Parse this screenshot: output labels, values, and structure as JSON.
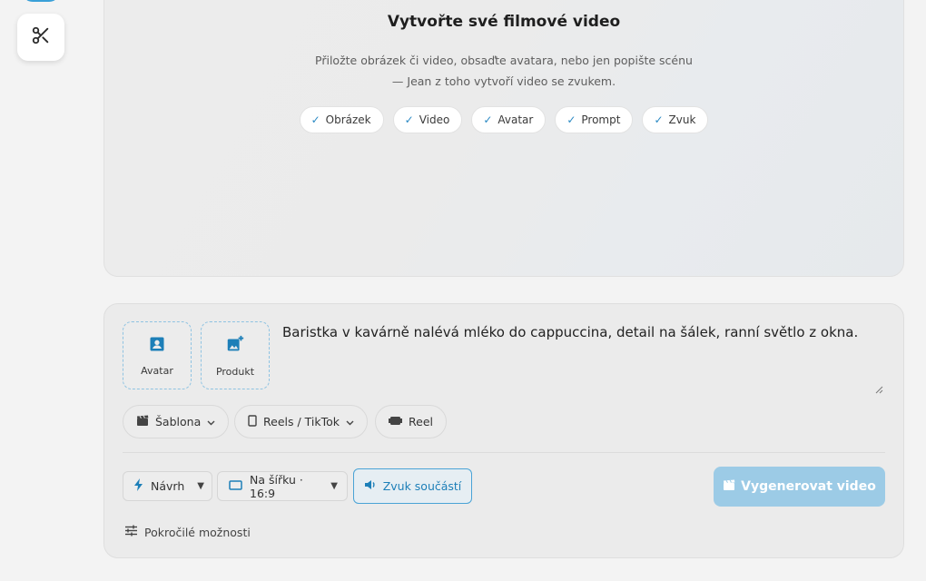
{
  "rail": {
    "tool_icon": "scissors-icon"
  },
  "hero": {
    "title": "Vytvořte své filmové video",
    "subtitle_line1": "Přiložte obrázek či video, obsaďte avatara, nebo jen popište scénu",
    "subtitle_line2": "— Jean z toho vytvoří video se zvukem.",
    "chips": [
      {
        "label": "Obrázek",
        "icon": "check-icon"
      },
      {
        "label": "Video",
        "icon": "check-icon"
      },
      {
        "label": "Avatar",
        "icon": "check-icon"
      },
      {
        "label": "Prompt",
        "icon": "check-icon"
      },
      {
        "label": "Zvuk",
        "icon": "check-icon"
      }
    ]
  },
  "composer": {
    "uploads": {
      "avatar_label": "Avatar",
      "product_label": "Produkt"
    },
    "prompt_text": "Baristka v kavárně nalévá mléko do cappuccina, detail na šálek, ranní světlo z okna.",
    "pills": {
      "template_label": "Šablona",
      "format_label": "Reels / TikTok",
      "reel_label": "Reel"
    },
    "mode_select": "Návrh",
    "aspect_select": "Na šířku · 16:9",
    "sound_toggle_label": "Zvuk součástí",
    "generate_label": "Vygenerovat video",
    "advanced_label": "Pokročilé možnosti"
  },
  "colors": {
    "accent": "#2c8ac4",
    "generate_disabled": "#9ccbe6",
    "background": "#f3f3f3"
  }
}
